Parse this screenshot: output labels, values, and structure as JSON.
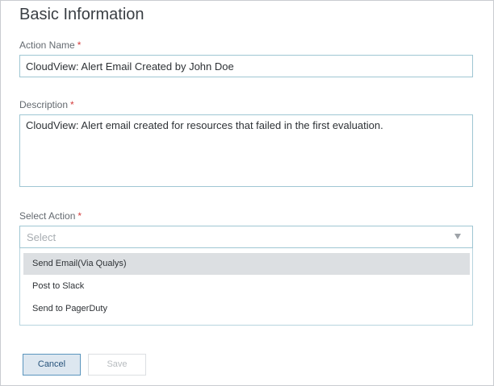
{
  "section": {
    "title": "Basic Information"
  },
  "action_name": {
    "label": "Action Name",
    "required_mark": "*",
    "value": "CloudView: Alert Email Created by John Doe"
  },
  "description": {
    "label": "Description",
    "required_mark": "*",
    "value": "CloudView: Alert email created for resources that failed in the first evaluation."
  },
  "select_action": {
    "label": "Select Action",
    "required_mark": "*",
    "placeholder": "Select",
    "options": [
      {
        "label": "Send Email(Via Qualys)",
        "highlighted": true
      },
      {
        "label": "Post to Slack",
        "highlighted": false
      },
      {
        "label": "Send to PagerDuty",
        "highlighted": false
      }
    ]
  },
  "buttons": {
    "cancel": "Cancel",
    "save": "Save"
  },
  "colors": {
    "accent_border": "#9fc6d3",
    "required": "#d43d3d",
    "primary_button_border": "#5a95bd",
    "highlight": "#dcdfe2"
  },
  "icons": {
    "dropdown_arrow": "caret-down-icon"
  }
}
